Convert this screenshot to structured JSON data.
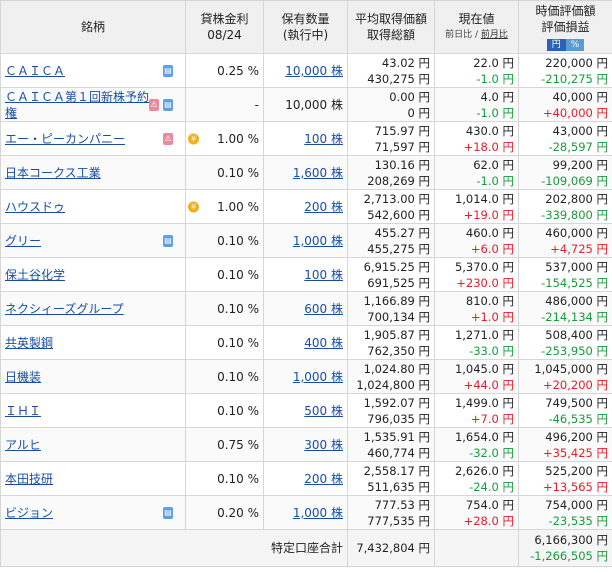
{
  "header": {
    "name": "銘柄",
    "rate_line1": "貸株金利",
    "rate_line2": "08/24",
    "qty_line1": "保有数量",
    "qty_line2": "(執行中)",
    "cost_line1": "平均取得価額",
    "cost_line2": "取得総額",
    "price_line1": "現在値",
    "price_sub1": "前日比",
    "price_sep": " / ",
    "price_sub2": "前月比",
    "value_line1": "時価評価額",
    "value_line2": "評価損益",
    "unit_yen": "円",
    "unit_pct": "%"
  },
  "colors": {
    "positive": "#e0202a",
    "negative": "#1a9a3a",
    "link": "#1a4ea3",
    "header_bg": "#f0f0f0"
  },
  "rows": [
    {
      "name": "ＣＡＩＣＡ",
      "icons": [
        "blue"
      ],
      "coin": false,
      "rate": "0.25 %",
      "qty": "10,000 株",
      "qty_link": true,
      "avg": "43.02 円",
      "total_cost": "430,275 円",
      "price": "22.0 円",
      "change": "-1.0 円",
      "change_dir": "neg",
      "value": "220,000 円",
      "pnl": "-210,275 円",
      "pnl_dir": "neg"
    },
    {
      "name": "ＣＡＩＣＡ第１回新株予約権",
      "icons": [
        "pink",
        "blue"
      ],
      "coin": false,
      "rate": "-",
      "qty": "10,000 株",
      "qty_link": false,
      "avg": "0.00 円",
      "total_cost": "0 円",
      "price": "4.0 円",
      "change": "-1.0 円",
      "change_dir": "neg",
      "value": "40,000 円",
      "pnl": "+40,000 円",
      "pnl_dir": "pos"
    },
    {
      "name": "エー・ピーカンパニー",
      "icons": [
        "pink"
      ],
      "coin": true,
      "rate": "1.00 %",
      "qty": "100 株",
      "qty_link": true,
      "avg": "715.97 円",
      "total_cost": "71,597 円",
      "price": "430.0 円",
      "change": "+18.0 円",
      "change_dir": "pos",
      "value": "43,000 円",
      "pnl": "-28,597 円",
      "pnl_dir": "neg"
    },
    {
      "name": "日本コークス工業",
      "icons": [],
      "coin": false,
      "rate": "0.10 %",
      "qty": "1,600 株",
      "qty_link": true,
      "avg": "130.16 円",
      "total_cost": "208,269 円",
      "price": "62.0 円",
      "change": "-1.0 円",
      "change_dir": "neg",
      "value": "99,200 円",
      "pnl": "-109,069 円",
      "pnl_dir": "neg"
    },
    {
      "name": "ハウスドゥ",
      "icons": [],
      "coin": true,
      "rate": "1.00 %",
      "qty": "200 株",
      "qty_link": true,
      "avg": "2,713.00 円",
      "total_cost": "542,600 円",
      "price": "1,014.0 円",
      "change": "+19.0 円",
      "change_dir": "pos",
      "value": "202,800 円",
      "pnl": "-339,800 円",
      "pnl_dir": "neg"
    },
    {
      "name": "グリー",
      "icons": [
        "blue"
      ],
      "coin": false,
      "rate": "0.10 %",
      "qty": "1,000 株",
      "qty_link": true,
      "avg": "455.27 円",
      "total_cost": "455,275 円",
      "price": "460.0 円",
      "change": "+6.0 円",
      "change_dir": "pos",
      "value": "460,000 円",
      "pnl": "+4,725 円",
      "pnl_dir": "pos"
    },
    {
      "name": "保土谷化学",
      "icons": [],
      "coin": false,
      "rate": "0.10 %",
      "qty": "100 株",
      "qty_link": true,
      "avg": "6,915.25 円",
      "total_cost": "691,525 円",
      "price": "5,370.0 円",
      "change": "+230.0 円",
      "change_dir": "pos",
      "value": "537,000 円",
      "pnl": "-154,525 円",
      "pnl_dir": "neg"
    },
    {
      "name": "ネクシィーズグループ",
      "icons": [],
      "coin": false,
      "rate": "0.10 %",
      "qty": "600 株",
      "qty_link": true,
      "avg": "1,166.89 円",
      "total_cost": "700,134 円",
      "price": "810.0 円",
      "change": "+1.0 円",
      "change_dir": "pos",
      "value": "486,000 円",
      "pnl": "-214,134 円",
      "pnl_dir": "neg"
    },
    {
      "name": "共英製鋼",
      "icons": [],
      "coin": false,
      "rate": "0.10 %",
      "qty": "400 株",
      "qty_link": true,
      "avg": "1,905.87 円",
      "total_cost": "762,350 円",
      "price": "1,271.0 円",
      "change": "-33.0 円",
      "change_dir": "neg",
      "value": "508,400 円",
      "pnl": "-253,950 円",
      "pnl_dir": "neg"
    },
    {
      "name": "日機装",
      "icons": [],
      "coin": false,
      "rate": "0.10 %",
      "qty": "1,000 株",
      "qty_link": true,
      "avg": "1,024.80 円",
      "total_cost": "1,024,800 円",
      "price": "1,045.0 円",
      "change": "+44.0 円",
      "change_dir": "pos",
      "value": "1,045,000 円",
      "pnl": "+20,200 円",
      "pnl_dir": "pos"
    },
    {
      "name": "ＩＨＩ",
      "icons": [],
      "coin": false,
      "rate": "0.10 %",
      "qty": "500 株",
      "qty_link": true,
      "avg": "1,592.07 円",
      "total_cost": "796,035 円",
      "price": "1,499.0 円",
      "change": "+7.0 円",
      "change_dir": "pos",
      "value": "749,500 円",
      "pnl": "-46,535 円",
      "pnl_dir": "neg"
    },
    {
      "name": "アルヒ",
      "icons": [],
      "coin": false,
      "rate": "0.75 %",
      "qty": "300 株",
      "qty_link": true,
      "avg": "1,535.91 円",
      "total_cost": "460,774 円",
      "price": "1,654.0 円",
      "change": "-32.0 円",
      "change_dir": "neg",
      "value": "496,200 円",
      "pnl": "+35,425 円",
      "pnl_dir": "pos"
    },
    {
      "name": "本田技研",
      "icons": [],
      "coin": false,
      "rate": "0.10 %",
      "qty": "200 株",
      "qty_link": true,
      "avg": "2,558.17 円",
      "total_cost": "511,635 円",
      "price": "2,626.0 円",
      "change": "-24.0 円",
      "change_dir": "neg",
      "value": "525,200 円",
      "pnl": "+13,565 円",
      "pnl_dir": "pos"
    },
    {
      "name": "ビジョン",
      "icons": [
        "blue"
      ],
      "coin": false,
      "rate": "0.20 %",
      "qty": "1,000 株",
      "qty_link": true,
      "avg": "777.53 円",
      "total_cost": "777,535 円",
      "price": "754.0 円",
      "change": "+28.0 円",
      "change_dir": "pos",
      "value": "754,000 円",
      "pnl": "-23,535 円",
      "pnl_dir": "neg"
    }
  ],
  "total": {
    "label": "特定口座合計",
    "cost": "7,432,804 円",
    "value": "6,166,300 円",
    "pnl": "-1,266,505 円",
    "pnl_dir": "neg"
  }
}
